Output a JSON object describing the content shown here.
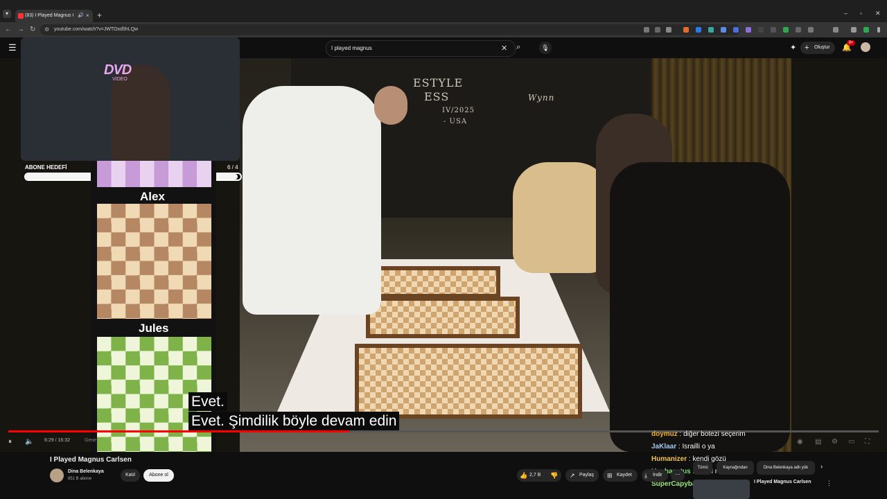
{
  "browser": {
    "tab_title": "(83) I Played Magnus Carlse",
    "tab_close": "×",
    "tab_audio": "🔊",
    "new_tab": "+",
    "url": "youtube.com/watch?v=JWTOxd5hLQw",
    "window_controls": {
      "minimize": "–",
      "restore": "▫",
      "close": "✕"
    },
    "nav": {
      "back": "←",
      "forward": "→",
      "reload": "↻"
    }
  },
  "masthead": {
    "menu_icon": "☰",
    "search_query": "I played magnus",
    "clear_icon": "✕",
    "search_icon": "⌕",
    "mic_icon": "🎙",
    "create_plus": "+",
    "create_label": "Oluştur",
    "notifications_badge": "9+",
    "bell_icon": "🔔"
  },
  "overlay": {
    "goal_label": "ABONE HEDEFİ",
    "goal_count": "6 / 4",
    "goal_progress": 1.0,
    "player_top": "Alex",
    "player_bottom": "Jules",
    "dvd_logo": "DVD",
    "dvd_sub": "VIDEO"
  },
  "scene_text": {
    "event_line1": "ESTYLE",
    "event_line2": "ESS",
    "event_line3": "IV/2025",
    "event_line4": "- USA",
    "wynn": "Wynn"
  },
  "subtitles": {
    "line1": "Evet.",
    "line2": "Evet.  Şimdilik böyle devam edin"
  },
  "player": {
    "time": "6:29 / 16:32",
    "chapter": "Gene",
    "progress": 0.392,
    "play_icon": "⏸",
    "volume_icon": "🔈"
  },
  "chat": [
    {
      "user": "doymuz",
      "text": "diğer botezi seçerim",
      "color": "#f2b134"
    },
    {
      "user": "JaKlaar",
      "text": "Israilli o ya",
      "color": "#9ecbf2"
    },
    {
      "user": "Humanizer",
      "text": "kendi gözü",
      "color": "#f2c24a"
    },
    {
      "user": "Hephaestus",
      "text": "kendi rengi",
      "color": "#7be07b"
    },
    {
      "user": "SuperCapybara89",
      "text": "",
      "color": "#9ee37d"
    }
  ],
  "video_info": {
    "title": "I Played Magnus Carlsen",
    "channel": "Dina Belenkaya",
    "subscribers": "851 B abone",
    "join_label": "Katıl",
    "subscribe_label": "Abone ol",
    "likes": "2,7 B",
    "share_label": "Paylaş",
    "save_label": "Kaydet",
    "download_label": "İndir",
    "more_icon": "⋯"
  },
  "chips": [
    "Tümü",
    "Kaynağından",
    "Dina Belenkaya adlı yük"
  ],
  "recommendation": {
    "title": "I Played Magnus Carlsen"
  }
}
